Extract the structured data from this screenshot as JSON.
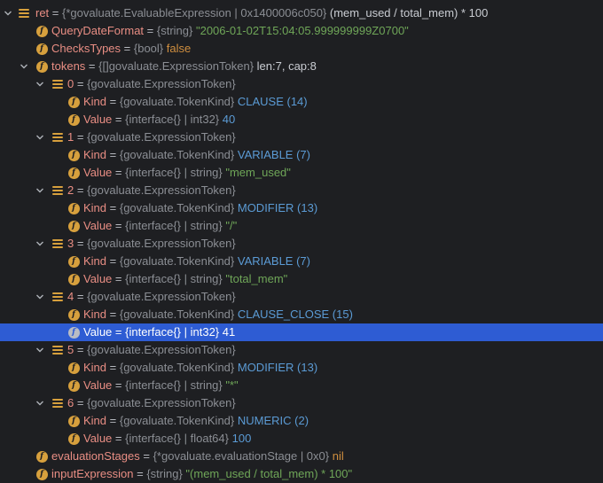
{
  "tree": {
    "top_cut_text": "",
    "root": {
      "name": "ret",
      "eq": " = ",
      "type": "{*govaluate.EvaluableExpression | 0x1400006c050}",
      "value": " (mem_used / total_mem) * 100"
    },
    "fields": [
      {
        "name": "QueryDateFormat",
        "eq": " = ",
        "type": "{string}",
        "value": " \"2006-01-02T15:04:05.999999999Z0700\""
      },
      {
        "name": "ChecksTypes",
        "eq": " = ",
        "type": "{bool}",
        "value": " false"
      },
      {
        "name": "tokens",
        "eq": " = ",
        "type": "{[]govaluate.ExpressionToken}",
        "value": " len:7, cap:8"
      }
    ],
    "tokens": [
      {
        "index": "0",
        "eq": " = ",
        "type": "{govaluate.ExpressionToken}",
        "kind": {
          "name": "Kind",
          "eq": " = ",
          "type": "{govaluate.TokenKind}",
          "value": " CLAUSE (14)"
        },
        "val": {
          "name": "Value",
          "eq": " = ",
          "type": "{interface{} | int32}",
          "value": " 40"
        }
      },
      {
        "index": "1",
        "eq": " = ",
        "type": "{govaluate.ExpressionToken}",
        "kind": {
          "name": "Kind",
          "eq": " = ",
          "type": "{govaluate.TokenKind}",
          "value": " VARIABLE (7)"
        },
        "val": {
          "name": "Value",
          "eq": " = ",
          "type": "{interface{} | string}",
          "value": " \"mem_used\""
        }
      },
      {
        "index": "2",
        "eq": " = ",
        "type": "{govaluate.ExpressionToken}",
        "kind": {
          "name": "Kind",
          "eq": " = ",
          "type": "{govaluate.TokenKind}",
          "value": " MODIFIER (13)"
        },
        "val": {
          "name": "Value",
          "eq": " = ",
          "type": "{interface{} | string}",
          "value": " \"/\""
        }
      },
      {
        "index": "3",
        "eq": " = ",
        "type": "{govaluate.ExpressionToken}",
        "kind": {
          "name": "Kind",
          "eq": " = ",
          "type": "{govaluate.TokenKind}",
          "value": " VARIABLE (7)"
        },
        "val": {
          "name": "Value",
          "eq": " = ",
          "type": "{interface{} | string}",
          "value": " \"total_mem\""
        }
      },
      {
        "index": "4",
        "eq": " = ",
        "type": "{govaluate.ExpressionToken}",
        "kind": {
          "name": "Kind",
          "eq": " = ",
          "type": "{govaluate.TokenKind}",
          "value": " CLAUSE_CLOSE (15)"
        },
        "val": {
          "name": "Value",
          "eq": " = ",
          "type": "{interface{} | int32}",
          "value": " 41"
        }
      },
      {
        "index": "5",
        "eq": " = ",
        "type": "{govaluate.ExpressionToken}",
        "kind": {
          "name": "Kind",
          "eq": " = ",
          "type": "{govaluate.TokenKind}",
          "value": " MODIFIER (13)"
        },
        "val": {
          "name": "Value",
          "eq": " = ",
          "type": "{interface{} | string}",
          "value": " \"*\""
        }
      },
      {
        "index": "6",
        "eq": " = ",
        "type": "{govaluate.ExpressionToken}",
        "kind": {
          "name": "Kind",
          "eq": " = ",
          "type": "{govaluate.TokenKind}",
          "value": " NUMERIC (2)"
        },
        "val": {
          "name": "Value",
          "eq": " = ",
          "type": "{interface{} | float64}",
          "value": " 100"
        }
      }
    ],
    "trailing": [
      {
        "name": "evaluationStages",
        "eq": " = ",
        "type": "{*govaluate.evaluationStage | 0x0}",
        "value": " nil"
      },
      {
        "name": "inputExpression",
        "eq": " = ",
        "type": "{string}",
        "value": " \"(mem_used / total_mem) * 100\""
      }
    ],
    "selected_token_index": 4
  },
  "colors": {
    "background": "#1e1f22",
    "selection": "#2e5cd3",
    "field_name": "#e98e84",
    "string_value": "#6fa658",
    "number_value": "#5b9bd5",
    "keyword_value": "#cf8e3f",
    "icon": "#d7a03d"
  },
  "icons": {
    "field": "field-f-icon",
    "list": "list-object-icon",
    "expand": "chevron-down-icon"
  }
}
